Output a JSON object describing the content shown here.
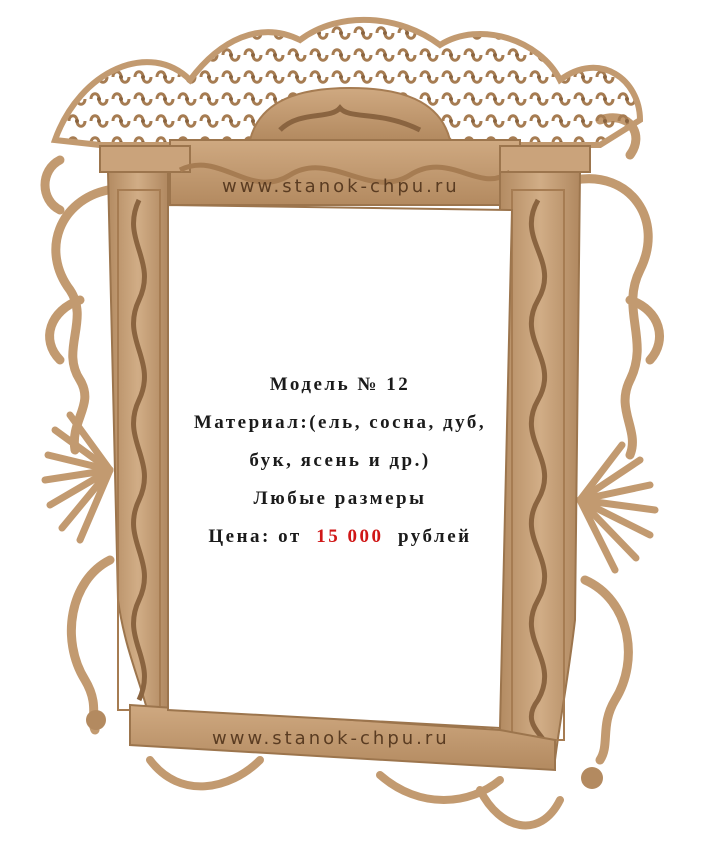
{
  "watermark": {
    "top": "www.stanok-chpu.ru",
    "bottom": "www.stanok-chpu.ru"
  },
  "info": {
    "model": "Модель № 12",
    "material_line1": "Материал:(ель, сосна, дуб,",
    "material_line2": "бук, ясень и др.)",
    "sizes": "Любые размеры",
    "price_label": "Цена: от",
    "price_value": "15 000",
    "price_currency": "рублей"
  },
  "colors": {
    "wood": "#c9a27a",
    "wood_dark": "#a67c52",
    "price": "#d01717"
  }
}
